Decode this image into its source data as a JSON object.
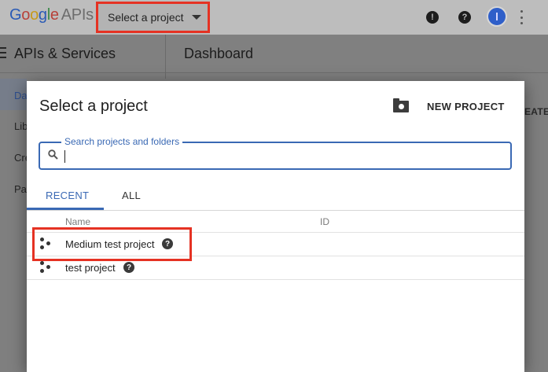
{
  "topbar": {
    "logo_google": "Google",
    "logo_apis": "APIs",
    "project_select_label": "Select a project"
  },
  "nav": {
    "section_title": "APIs & Services",
    "page_title": "Dashboard",
    "sidebar_items": [
      "Da",
      "Lib",
      "Cre",
      "Pa"
    ],
    "create_partial": "EATE"
  },
  "dialog": {
    "title": "Select a project",
    "new_project_label": "NEW PROJECT",
    "search": {
      "label": "Search projects and folders",
      "value": "",
      "placeholder": ""
    },
    "tabs": [
      {
        "label": "RECENT",
        "active": true
      },
      {
        "label": "ALL",
        "active": false
      }
    ],
    "columns": {
      "name": "Name",
      "id": "ID"
    },
    "projects": [
      {
        "name": "Medium test project",
        "id": ""
      },
      {
        "name": "test project",
        "id": ""
      }
    ]
  },
  "colors": {
    "accent": "#3a69b4",
    "highlight": "#e53223",
    "topbar_bg": "#bdbdbd",
    "overlay_bg": "#7f7f7f"
  },
  "icons": {
    "alert": "alert-icon",
    "help": "help-icon",
    "avatar": "avatar",
    "more": "more-vert-icon",
    "menu": "menu-icon",
    "new_project": "create-folder-icon",
    "search": "search-icon",
    "project": "project-icon"
  }
}
